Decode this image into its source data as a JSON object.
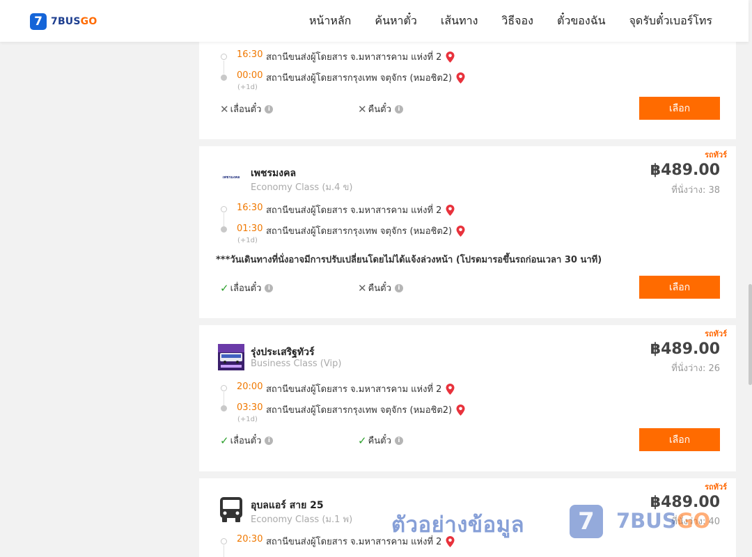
{
  "brand": {
    "mark": "7",
    "name_part1": "7BUS",
    "name_part2": "GO"
  },
  "nav": [
    "หน้าหลัก",
    "ค้นหาตั๋ว",
    "เส้นทาง",
    "วิธีจอง",
    "ตั๋วของฉัน",
    "จุดรับตั๋วเบอร์โทร"
  ],
  "cards": [
    {
      "depart_time": "16:30",
      "depart_station": "สถานีขนส่งผู้โดยสาร จ.มหาสารคาม แห่งที่ 2",
      "arrive_time": "00:00",
      "arrive_station": "สถานีขนส่งผู้โดยสารกรุงเทพ จตุจักร (หมอชิต2)",
      "next_day": "(+1d)",
      "change_label": "เลื่อนตั๋ว",
      "change_allowed": false,
      "refund_label": "คืนตั๋ว",
      "refund_allowed": false,
      "select_label": "เลือก"
    },
    {
      "badge": "รถทัวร์",
      "operator": "เพชรมงคล",
      "operator_logo_text": "เพชรมงคล",
      "bus_class": "Economy Class (ม.4 ข)",
      "price": "฿489.00",
      "seats": "ที่นั่งว่าง: 38",
      "depart_time": "16:30",
      "depart_station": "สถานีขนส่งผู้โดยสาร จ.มหาสารคาม แห่งที่ 2",
      "arrive_time": "01:30",
      "arrive_station": "สถานีขนส่งผู้โดยสารกรุงเทพ จตุจักร (หมอชิต2)",
      "next_day": "(+1d)",
      "notice": "***วันเดินทางที่นั่งอาจมีการปรับเปลี่ยนโดยไม่ได้แจ้งล่วงหน้า (โปรดมารอขึ้นรถก่อนเวลา 30 นาที)",
      "change_label": "เลื่อนตั๋ว",
      "change_allowed": true,
      "refund_label": "คืนตั๋ว",
      "refund_allowed": false,
      "select_label": "เลือก"
    },
    {
      "badge": "รถทัวร์",
      "operator": "รุ่งประเสริฐทัวร์",
      "bus_class": "Business Class (Vip)",
      "price": "฿489.00",
      "seats": "ที่นั่งว่าง: 26",
      "depart_time": "20:00",
      "depart_station": "สถานีขนส่งผู้โดยสาร จ.มหาสารคาม แห่งที่ 2",
      "arrive_time": "03:30",
      "arrive_station": "สถานีขนส่งผู้โดยสารกรุงเทพ จตุจักร (หมอชิต2)",
      "next_day": "(+1d)",
      "change_label": "เลื่อนตั๋ว",
      "change_allowed": true,
      "refund_label": "คืนตั๋ว",
      "refund_allowed": true,
      "select_label": "เลือก"
    },
    {
      "badge": "รถทัวร์",
      "operator": "อุบลแอร์ สาย 25",
      "bus_class": "Economy Class (ม.1 พ)",
      "price": "฿489.00",
      "seats": "ที่นั่งว่าง: 40",
      "depart_time": "20:30",
      "depart_station": "สถานีขนส่งผู้โดยสาร จ.มหาสารคาม แห่งที่ 2"
    }
  ],
  "watermark": {
    "text": "ตัวอย่างข้อมูล",
    "logo_mark": "7",
    "brand_part1": "7BUS",
    "brand_part2": "GO"
  },
  "colors": {
    "accent": "#ff6b00",
    "brand_blue": "#1565d8",
    "time_orange": "#f07800"
  },
  "icons": {
    "pin": "map-pin-icon",
    "info": "info-icon",
    "cross": "cross-icon",
    "check": "check-icon",
    "bus": "bus-icon"
  }
}
